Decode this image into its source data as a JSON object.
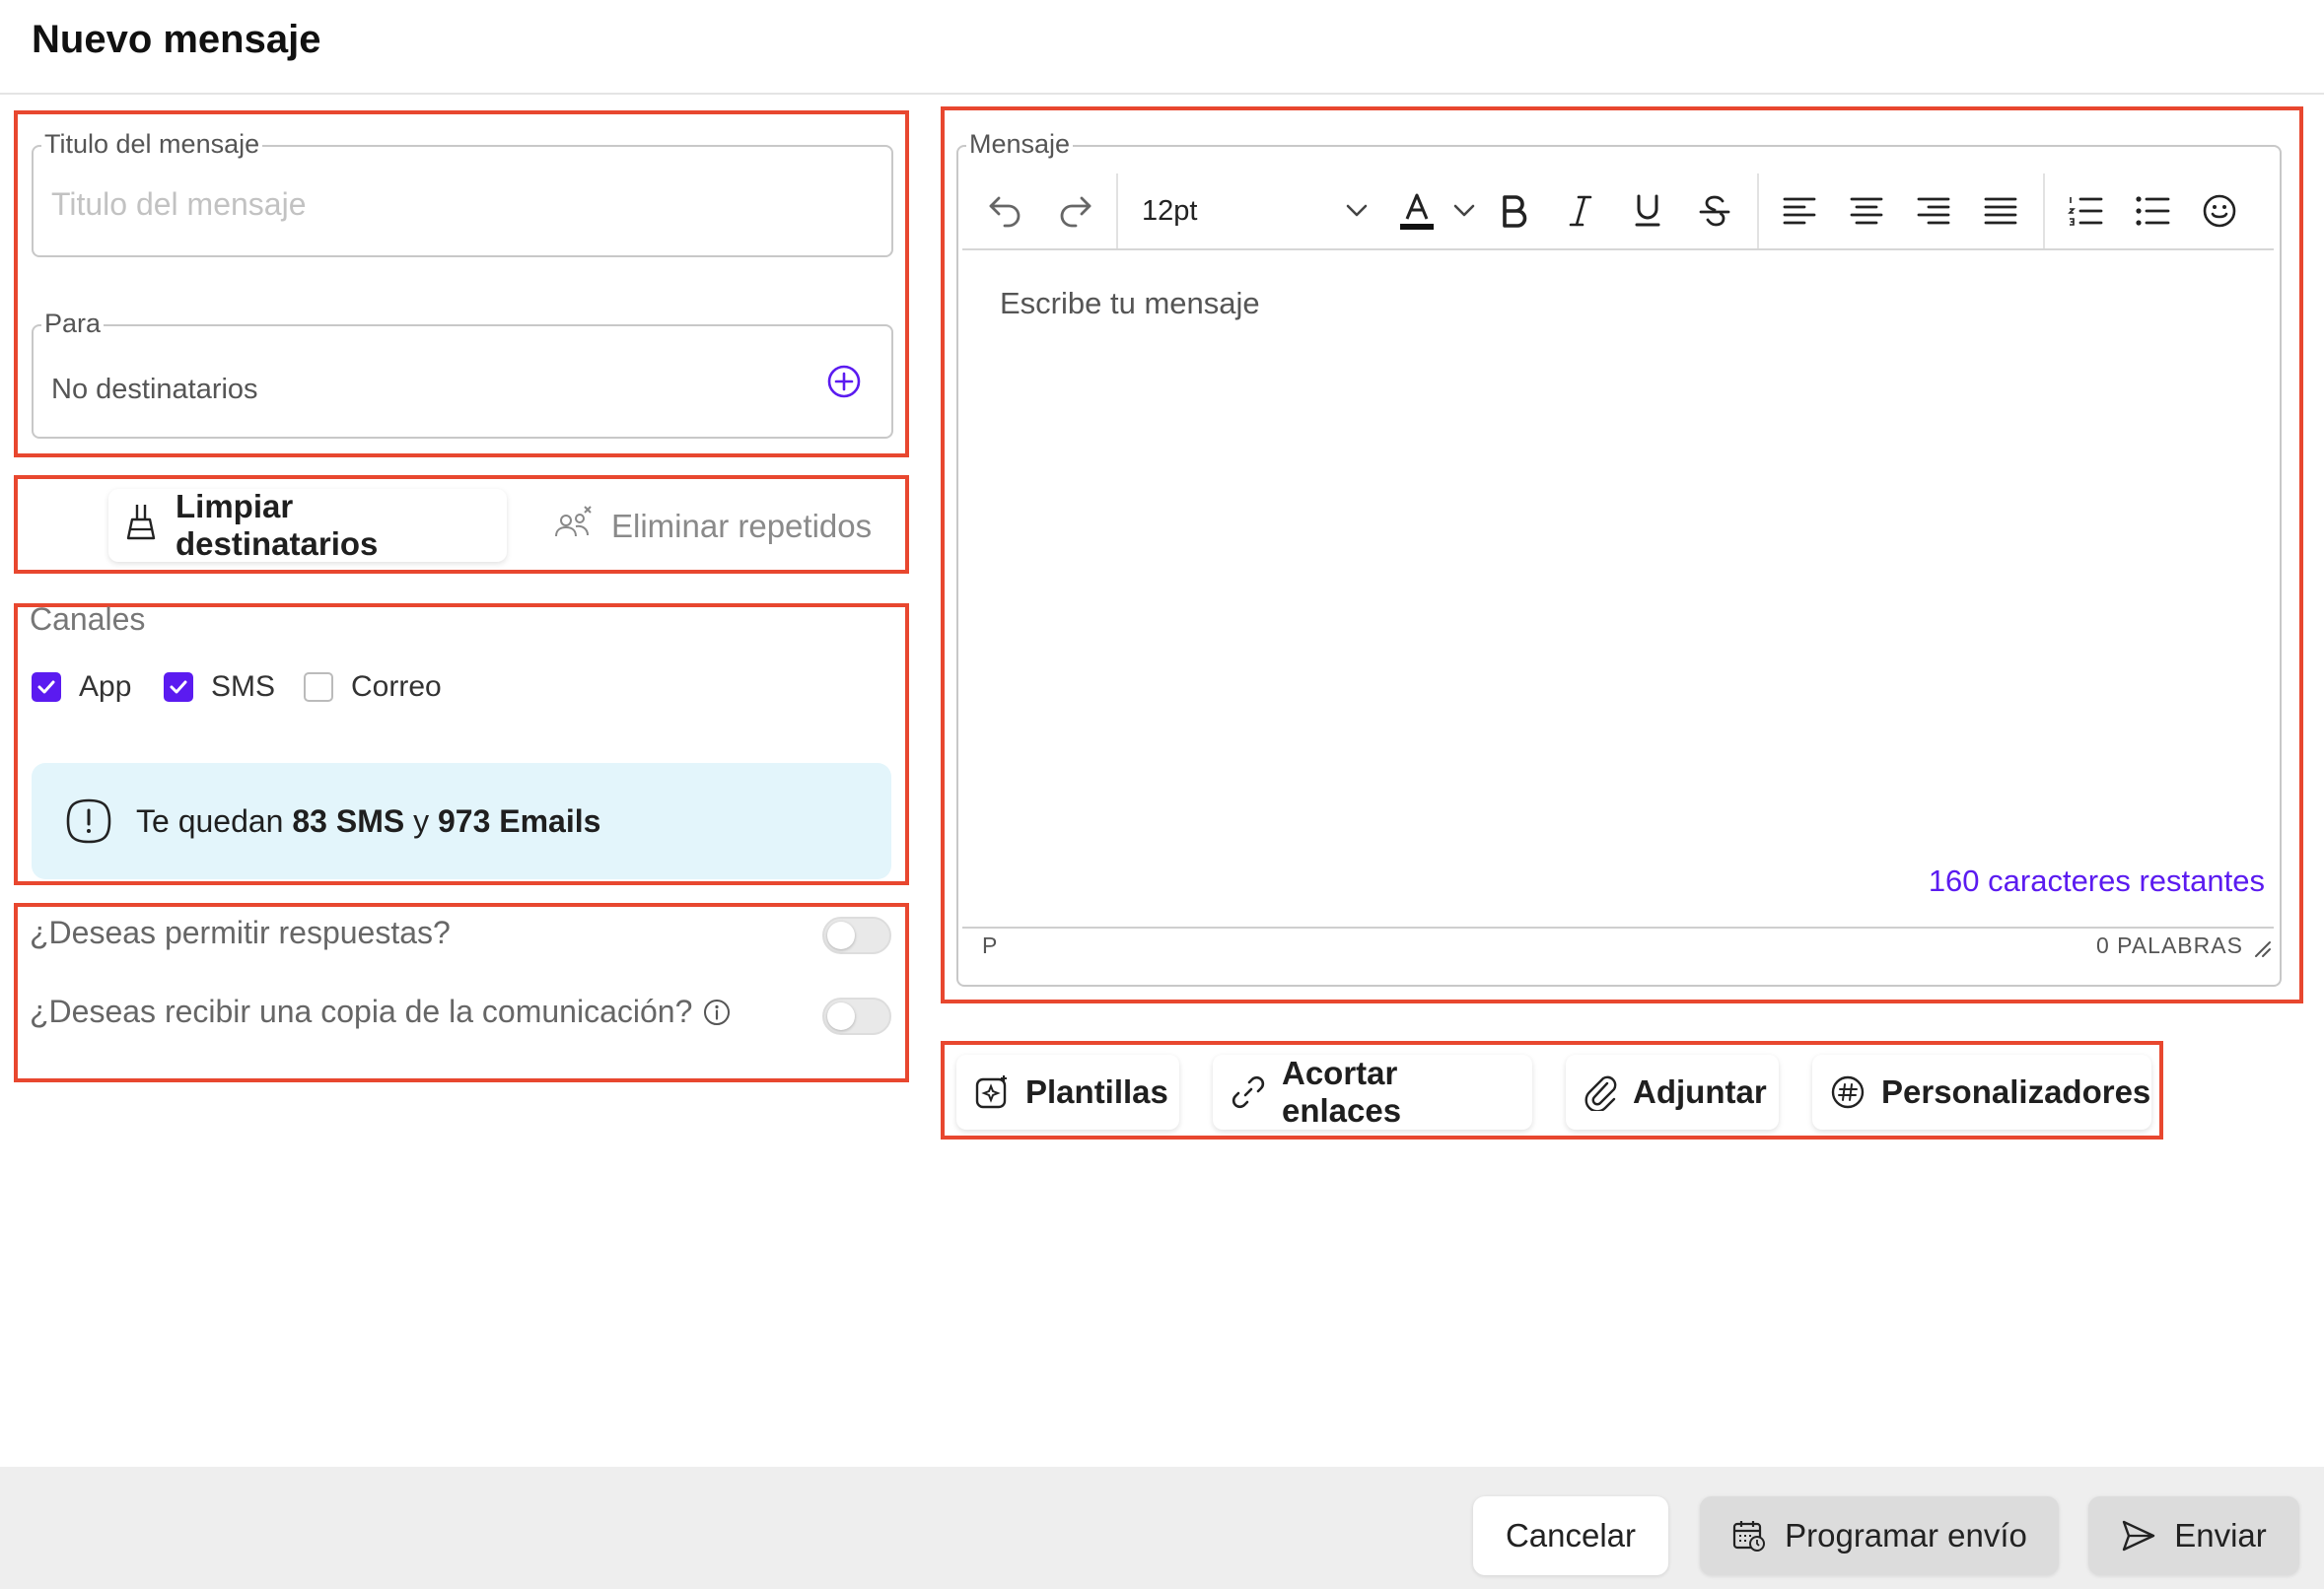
{
  "header": {
    "title": "Nuevo mensaje"
  },
  "titulo": {
    "label": "Titulo del mensaje",
    "placeholder": "Titulo del mensaje"
  },
  "para": {
    "label": "Para",
    "value": "No destinatarios"
  },
  "recipient_actions": {
    "clear_label": "Limpiar destinatarios",
    "dedupe_label": "Eliminar repetidos"
  },
  "canales": {
    "label": "Canales",
    "options": [
      {
        "label": "App",
        "checked": true
      },
      {
        "label": "SMS",
        "checked": true
      },
      {
        "label": "Correo",
        "checked": false
      }
    ]
  },
  "quota": {
    "prefix": "Te quedan",
    "sms": "83 SMS",
    "joiner": "y",
    "emails": "973 Emails"
  },
  "toggles": {
    "respuestas": {
      "label": "¿Deseas permitir respuestas?",
      "on": false
    },
    "copia": {
      "label": "¿Deseas recibir una copia de la comunicación?",
      "on": false
    }
  },
  "editor": {
    "label": "Mensaje",
    "font_size": "12pt",
    "placeholder": "Escribe tu mensaje",
    "remaining": "160 caracteres restantes",
    "status_path": "P",
    "word_count": "0 PALABRAS"
  },
  "actions": {
    "templates": "Plantillas",
    "shorten": "Acortar enlaces",
    "attach": "Adjuntar",
    "personalize": "Personalizadores"
  },
  "footer": {
    "cancel": "Cancelar",
    "schedule": "Programar envío",
    "send": "Enviar"
  },
  "colors": {
    "accent": "#5b1bf0",
    "highlight": "#e8472f",
    "info_bg": "#e3f5fb",
    "footer_bg": "#eeeeee"
  }
}
